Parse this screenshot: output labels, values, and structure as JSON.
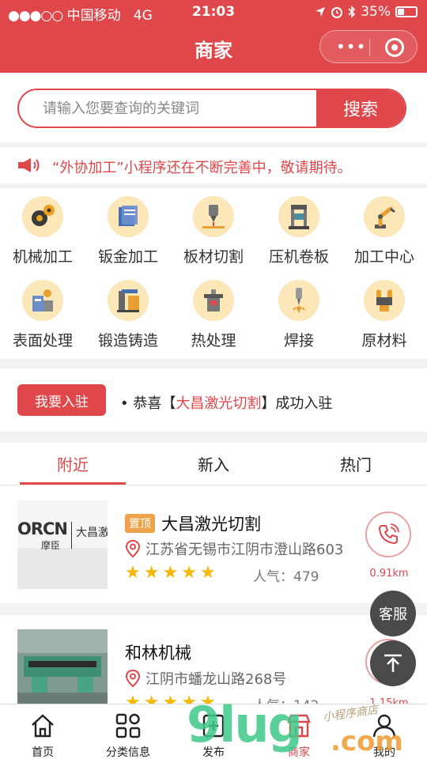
{
  "status_bar": {
    "carrier": "中国移动",
    "network": "4G",
    "time": "21:03",
    "battery": "35%",
    "battery_level": 0.35
  },
  "header": {
    "title": "商家"
  },
  "search": {
    "placeholder": "请输入您要查询的关键词",
    "button": "搜索"
  },
  "notice": {
    "text": "“外协加工”小程序还在不断完善中，敬请期待。"
  },
  "categories": [
    {
      "label": "机械加工",
      "icon": "gears-icon"
    },
    {
      "label": "钣金加工",
      "icon": "sheet-metal-icon"
    },
    {
      "label": "板材切割",
      "icon": "cutting-icon"
    },
    {
      "label": "压机卷板",
      "icon": "press-icon"
    },
    {
      "label": "加工中心",
      "icon": "robot-arm-icon"
    },
    {
      "label": "表面处理",
      "icon": "surface-treatment-icon"
    },
    {
      "label": "锻造铸造",
      "icon": "forging-icon"
    },
    {
      "label": "热处理",
      "icon": "heat-treatment-icon"
    },
    {
      "label": "焊接",
      "icon": "welding-icon"
    },
    {
      "label": "原材料",
      "icon": "raw-material-icon"
    }
  ],
  "join": {
    "button": "我要入驻",
    "bullet": "•",
    "prefix": "恭喜【",
    "company": "大昌激光切割",
    "suffix": "】成功入驻"
  },
  "tabs": [
    "附近",
    "新入",
    "热门"
  ],
  "shops": [
    {
      "tag": "置顶",
      "name": "大昌激光切割",
      "address": "江苏省无锡市江阴市澄山路603",
      "rating": 5,
      "popularity_label": "人气：",
      "popularity": "479",
      "distance": "0.91km",
      "logo_text": "ORCN",
      "logo_sub": "摩臣",
      "logo_right": "大昌激"
    },
    {
      "name": "和林机械",
      "address": "江阴市蟠龙山路268号",
      "rating": 5,
      "popularity_label": "人气：",
      "popularity": "142",
      "distance": "1.15km"
    }
  ],
  "floating": {
    "service": "客服"
  },
  "bottom_nav": [
    {
      "label": "首页",
      "icon": "home-icon"
    },
    {
      "label": "分类信息",
      "icon": "grid-icon"
    },
    {
      "label": "发布",
      "icon": "publish-icon"
    },
    {
      "label": "商家",
      "icon": "store-icon"
    },
    {
      "label": "我的",
      "icon": "user-icon"
    }
  ],
  "watermark": {
    "main": "9lug",
    "com": ".com",
    "small": "小程序商店"
  },
  "colors": {
    "brand": "#e0474b",
    "star": "#f5b800",
    "tag": "#f0a24a"
  }
}
